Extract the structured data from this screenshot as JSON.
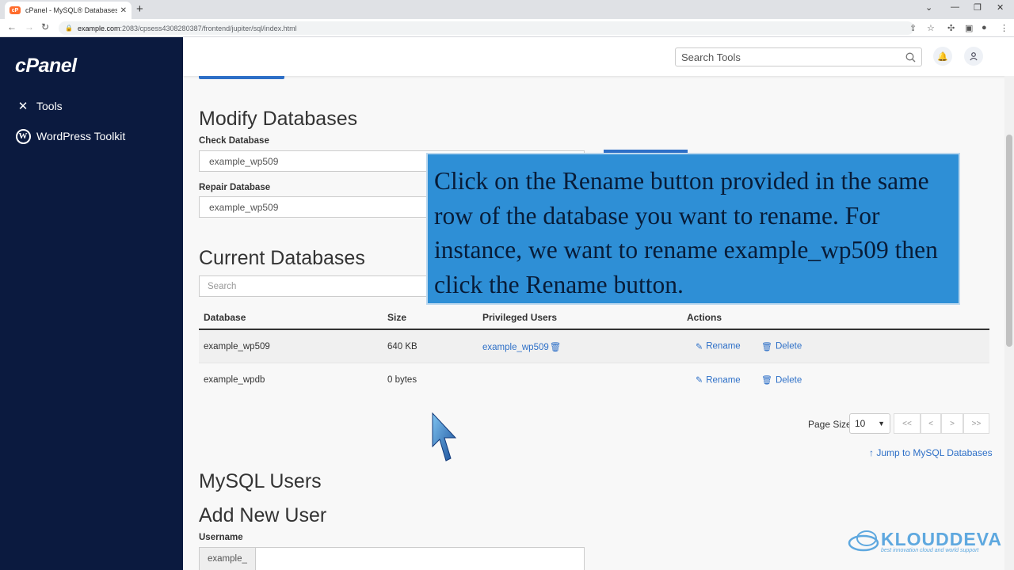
{
  "browser": {
    "tab_title": "cPanel - MySQL® Databases",
    "favicon_text": "cP",
    "new_tab": "+",
    "tab_close": "✕",
    "url_host": "example.com",
    "url_path": ":2083/cpsess4308280387/frontend/jupiter/sql/index.html"
  },
  "sidebar": {
    "logo": "cPanel",
    "items": [
      {
        "label": "Tools",
        "icon": "tools-icon"
      },
      {
        "label": "WordPress Toolkit",
        "icon": "wordpress-icon"
      }
    ]
  },
  "header": {
    "search_placeholder": "Search Tools"
  },
  "modify": {
    "title": "Modify Databases",
    "check_label": "Check Database",
    "check_value": "example_wp509",
    "repair_label": "Repair Database",
    "repair_value": "example_wp509"
  },
  "current": {
    "title": "Current Databases",
    "search_placeholder": "Search",
    "columns": [
      "Database",
      "Size",
      "Privileged Users",
      "Actions"
    ],
    "rows": [
      {
        "database": "example_wp509",
        "size": "640 KB",
        "user": "example_wp509",
        "rename": "Rename",
        "delete": "Delete"
      },
      {
        "database": "example_wpdb",
        "size": "0 bytes",
        "user": "",
        "rename": "Rename",
        "delete": "Delete"
      }
    ],
    "page_size_label": "Page Size",
    "page_size_value": "10",
    "pager": [
      "<<",
      "<",
      ">",
      ">>"
    ],
    "jump_link": "Jump to MySQL Databases"
  },
  "users": {
    "title": "MySQL Users",
    "add_title": "Add New User",
    "username_label": "Username",
    "username_prefix": "example_"
  },
  "callout": {
    "text": "Click on the Rename button provided in the same row of the database you want to rename. For instance, we want to rename example_wp509 then click the Rename button."
  },
  "watermark": {
    "name": "KLOUDDEVA",
    "tagline": "best innovation cloud and world support"
  },
  "colors": {
    "sidebar": "#0b1a3f",
    "link": "#2d6fc7",
    "callout_bg": "#2e8fd6"
  }
}
